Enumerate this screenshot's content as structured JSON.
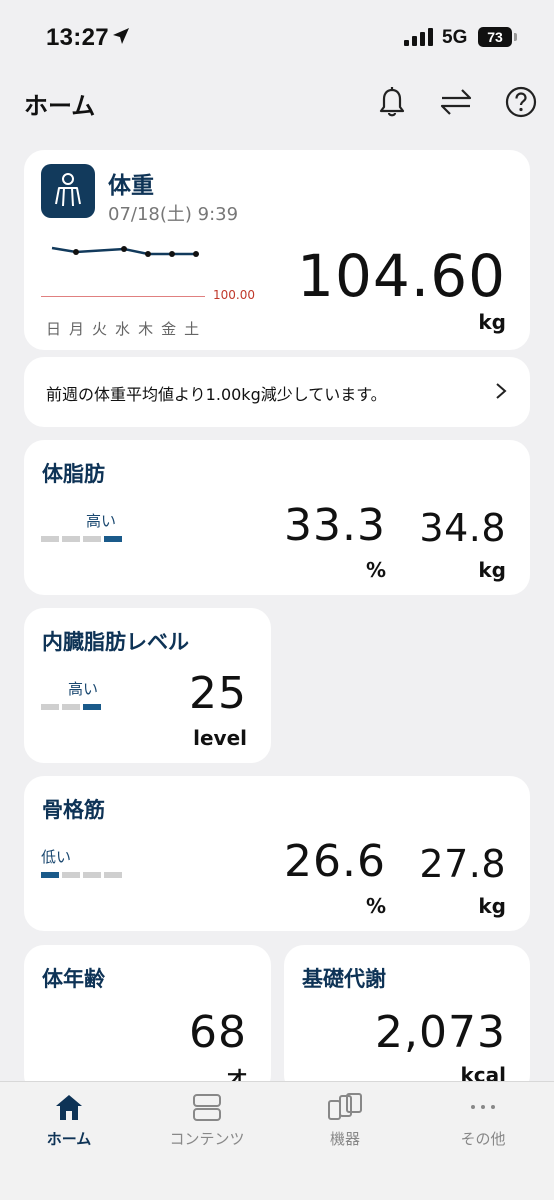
{
  "status_bar": {
    "time": "13:27",
    "network": "5G",
    "battery": "73"
  },
  "header": {
    "title": "ホーム"
  },
  "weight_card": {
    "title": "体重",
    "date": "07/18(土) 9:39",
    "value": "104.60",
    "unit": "kg",
    "reference_label": "100.00",
    "days": [
      "日",
      "月",
      "火",
      "水",
      "木",
      "金",
      "土"
    ]
  },
  "message": {
    "text": "前週の体重平均値より1.00kg減少しています。"
  },
  "body_fat": {
    "title": "体脂肪",
    "level_label": "高い",
    "percent_value": "33.3",
    "percent_unit": "%",
    "mass_value": "34.8",
    "mass_unit": "kg"
  },
  "visceral_fat": {
    "title": "内臓脂肪レベル",
    "level_label": "高い",
    "value": "25",
    "unit": "level"
  },
  "skeletal_muscle": {
    "title": "骨格筋",
    "level_label": "低い",
    "percent_value": "26.6",
    "percent_unit": "%",
    "mass_value": "27.8",
    "mass_unit": "kg"
  },
  "body_age": {
    "title": "体年齢",
    "value": "68",
    "unit": "才"
  },
  "bmr": {
    "title": "基礎代謝",
    "value": "2,073",
    "unit": "kcal"
  },
  "tabs": [
    {
      "label": "ホーム",
      "icon": "home-icon"
    },
    {
      "label": "コンテンツ",
      "icon": "contents-icon"
    },
    {
      "label": "機器",
      "icon": "devices-icon"
    },
    {
      "label": "その他",
      "icon": "more-icon"
    }
  ],
  "colors": {
    "accent": "#0e3356",
    "reference_line": "#e08080",
    "background": "#f0f0f2"
  }
}
